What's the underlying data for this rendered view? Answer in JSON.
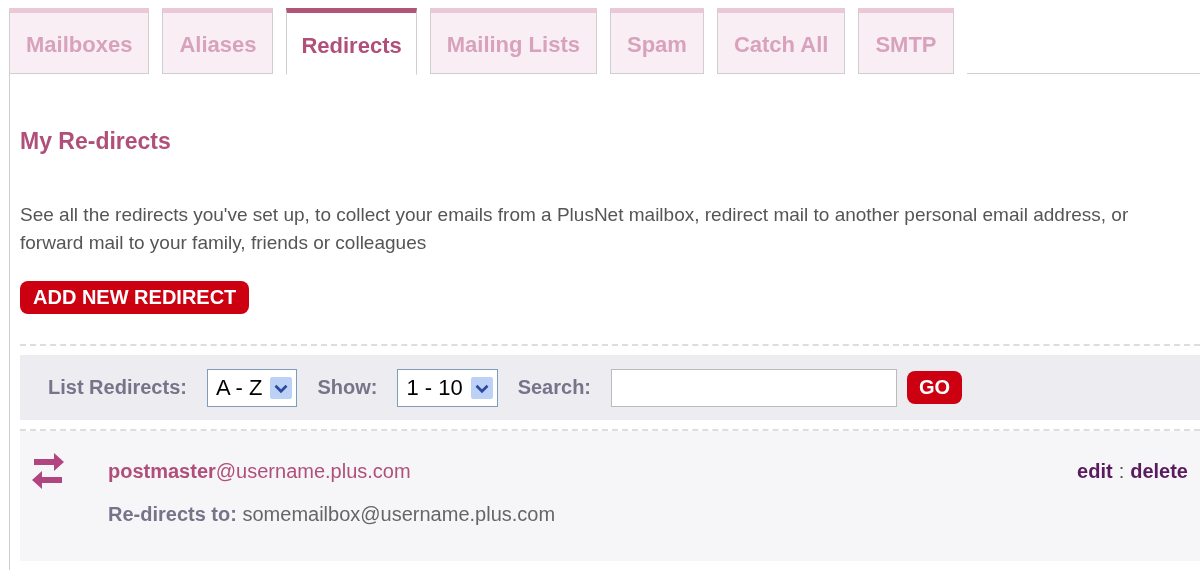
{
  "tabs": [
    {
      "label": "Mailboxes",
      "selected": false
    },
    {
      "label": "Aliases",
      "selected": false
    },
    {
      "label": "Redirects",
      "selected": true
    },
    {
      "label": "Mailing Lists",
      "selected": false
    },
    {
      "label": "Spam",
      "selected": false
    },
    {
      "label": "Catch All",
      "selected": false
    },
    {
      "label": "SMTP",
      "selected": false
    }
  ],
  "heading": "My Re-directs",
  "description": "See all the redirects you've set up, to collect your emails from a PlusNet mailbox, redirect mail to another personal email address, or forward mail to your family, friends or colleagues",
  "add_button": "ADD NEW REDIRECT",
  "filter": {
    "list_label": "List Redirects:",
    "list_value": "A - Z",
    "show_label": "Show:",
    "show_value": "1 - 10",
    "search_label": "Search:",
    "go_button": "GO"
  },
  "redirects": [
    {
      "address": "**postmaster**@username.plus.com",
      "edit": "edit",
      "separator": ":",
      "delete": "delete",
      "target_label": "Re-directs to:",
      "target": "somemailbox@username.plus.com"
    }
  ]
}
